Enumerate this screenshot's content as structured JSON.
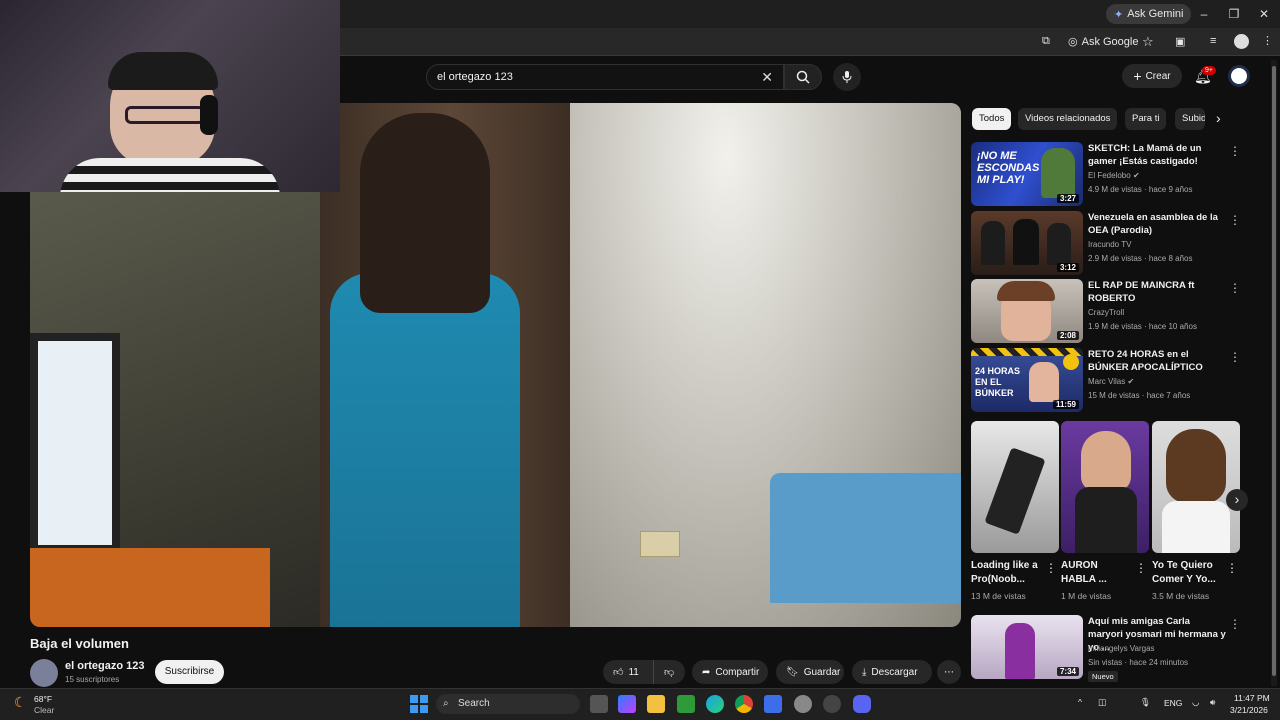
{
  "browser": {
    "ask_gemini": "Ask Gemini",
    "ask_google": "Ask Google"
  },
  "header": {
    "search_value": "el ortegazo 123",
    "create_label": "Crear",
    "notif_count": "9+"
  },
  "video": {
    "title": "Baja el volumen",
    "channel": "el ortegazo 123",
    "subscribers": "15 suscriptores",
    "subscribe_label": "Suscribirse",
    "likes": "11",
    "share_label": "Compartir",
    "save_label": "Guardar",
    "download_label": "Descargar"
  },
  "chips": [
    "Todos",
    "Videos relacionados",
    "Para ti",
    "Subid"
  ],
  "recommendations": [
    {
      "title": "SKETCH: La Mamá de un gamer ¡Estás castigado!",
      "channel": "El Fedelobo",
      "meta": "4.9 M de vistas · hace 9 años",
      "duration": "3:27",
      "thumb_text": "¡NO ME ESCONDAS MI PLAY!"
    },
    {
      "title": "Venezuela en asamblea de la OEA (Parodia)",
      "channel": "Iracundo TV",
      "meta": "2.9 M de vistas · hace 8 años",
      "duration": "3:12",
      "thumb_text": ""
    },
    {
      "title": "EL RAP DE MAINCRA ft ROBERTO",
      "channel": "CrazyTroll",
      "meta": "1.9 M de vistas · hace 10 años",
      "duration": "2:08",
      "thumb_text": ""
    },
    {
      "title": "RETO 24 HORAS en el BÚNKER APOCALÍPTICO",
      "channel": "Marc Vilas",
      "meta": "15 M de vistas · hace 7 años",
      "duration": "11:59",
      "thumb_text": "24 HORAS EN EL BÚNKER"
    }
  ],
  "shorts": [
    {
      "title": "Loading like a Pro(Noob...",
      "views": "13 M de vistas"
    },
    {
      "title": "AURON HABLA ...",
      "views": "1 M de vistas"
    },
    {
      "title": "Yo Te Quiero Comer Y Yo...",
      "views": "3.5 M de vistas"
    }
  ],
  "last_rec": {
    "title": "Aquí mis amigas Carla maryori yosmari mi hermana y yo ...",
    "channel": "miliangelys Vargas",
    "meta": "Sin vistas · hace 24 minutos",
    "duration": "7:34",
    "badge": "Nuevo"
  },
  "taskbar": {
    "weather_temp": "68°F",
    "weather_desc": "Clear",
    "search_label": "Search",
    "lang": "ENG",
    "time": "11:47 PM",
    "date": "3/21/2026"
  },
  "colors": {
    "accent_red": "#cc0000",
    "bg": "#0f0f0f"
  }
}
